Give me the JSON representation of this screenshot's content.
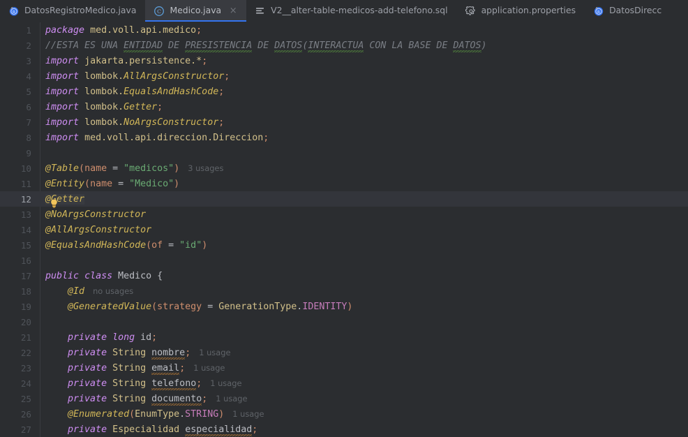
{
  "window": {
    "app": "IntelliJ IDEA",
    "theme_bg": "#2b2d30",
    "accent": "#3574f0"
  },
  "tabbar": {
    "tabs": [
      {
        "label": "DatosRegistroMedico.java",
        "icon": "java-record-icon",
        "active": false,
        "closable": false
      },
      {
        "label": "Medico.java",
        "icon": "java-class-icon",
        "active": true,
        "closable": true,
        "close_label": "×"
      },
      {
        "label": "V2__alter-table-medicos-add-telefono.sql",
        "icon": "sql-file-icon",
        "active": false,
        "closable": false
      },
      {
        "label": "application.properties",
        "icon": "gear-icon",
        "active": false,
        "closable": false
      },
      {
        "label": "DatosDirecc",
        "icon": "java-record-icon",
        "active": false,
        "closable": false
      }
    ]
  },
  "editor": {
    "file": "Medico.java",
    "current_line": 12,
    "lines": [
      {
        "n": 1,
        "text": "package med.voll.api.medico;"
      },
      {
        "n": 2,
        "text": "//ESTA ES UNA ENTIDAD DE PRESISTENCIA DE DATOS(INTERACTUA CON LA BASE DE DATOS)"
      },
      {
        "n": 3,
        "text": "import jakarta.persistence.*;"
      },
      {
        "n": 4,
        "text": "import lombok.AllArgsConstructor;"
      },
      {
        "n": 5,
        "text": "import lombok.EqualsAndHashCode;"
      },
      {
        "n": 6,
        "text": "import lombok.Getter;"
      },
      {
        "n": 7,
        "text": "import lombok.NoArgsConstructor;"
      },
      {
        "n": 8,
        "text": "import med.voll.api.direccion.Direccion;"
      },
      {
        "n": 9,
        "text": ""
      },
      {
        "n": 10,
        "text": "@Table(name = \"medicos\")",
        "hint": "3 usages"
      },
      {
        "n": 11,
        "text": "@Entity(name = \"Medico\")",
        "bulb": true
      },
      {
        "n": 12,
        "text": "@Getter"
      },
      {
        "n": 13,
        "text": "@NoArgsConstructor"
      },
      {
        "n": 14,
        "text": "@AllArgsConstructor"
      },
      {
        "n": 15,
        "text": "@EqualsAndHashCode(of = \"id\")"
      },
      {
        "n": 16,
        "text": ""
      },
      {
        "n": 17,
        "text": "public class Medico {"
      },
      {
        "n": 18,
        "text": "    @Id",
        "hint": "no usages"
      },
      {
        "n": 19,
        "text": "    @GeneratedValue(strategy = GenerationType.IDENTITY)"
      },
      {
        "n": 20,
        "text": ""
      },
      {
        "n": 21,
        "text": "    private long id;"
      },
      {
        "n": 22,
        "text": "    private String nombre;",
        "hint": "1 usage"
      },
      {
        "n": 23,
        "text": "    private String email;",
        "hint": "1 usage"
      },
      {
        "n": 24,
        "text": "    private String telefono;",
        "hint": "1 usage"
      },
      {
        "n": 25,
        "text": "    private String documento;",
        "hint": "1 usage"
      },
      {
        "n": 26,
        "text": "    @Enumerated(EnumType.STRING)",
        "hint": "1 usage"
      },
      {
        "n": 27,
        "text": "    private Especialidad especialidad;"
      }
    ],
    "hints": {
      "three_usages": "3 usages",
      "no_usages": "no usages",
      "one_usage": "1 usage"
    },
    "tokens": {
      "line1": {
        "kw": "package",
        "path": "med.voll.api.medico",
        "semi": ";"
      },
      "line2": {
        "comment_prefix": "//",
        "c1": "ESTA ES UNA ",
        "c2": "ENTIDAD",
        "c3": " DE ",
        "c4": "PRESISTENCIA",
        "c5": " DE ",
        "c6": "DATOS",
        "c7": "(",
        "c8": "INTERACTUA",
        "c9": " CON LA BASE DE ",
        "c10": "DATOS",
        "c11": ")"
      },
      "line3": {
        "kw": "import",
        "path": "jakarta.persistence.*",
        "semi": ";"
      },
      "line4": {
        "kw": "import",
        "pkg": "lombok.",
        "cls": "AllArgsConstructor",
        "semi": ";"
      },
      "line5": {
        "kw": "import",
        "pkg": "lombok.",
        "cls": "EqualsAndHashCode",
        "semi": ";"
      },
      "line6": {
        "kw": "import",
        "pkg": "lombok.",
        "cls": "Getter",
        "semi": ";"
      },
      "line7": {
        "kw": "import",
        "pkg": "lombok.",
        "cls": "NoArgsConstructor",
        "semi": ";"
      },
      "line8": {
        "kw": "import",
        "pkg": "med.voll.api.direccion.",
        "cls": "Direccion",
        "semi": ";"
      },
      "line10": {
        "anno": "@Table",
        "open": "(",
        "param": "name",
        "eq": " = ",
        "str": "\"medicos\"",
        "close": ")"
      },
      "line11": {
        "anno": "@Entity",
        "open": "(",
        "param": "name",
        "eq": " = ",
        "str": "\"Medico\"",
        "close": ")"
      },
      "line12": {
        "anno": "@Getter"
      },
      "line13": {
        "anno": "@NoArgsConstructor"
      },
      "line14": {
        "anno": "@AllArgsConstructor"
      },
      "line15": {
        "anno": "@EqualsAndHashCode",
        "open": "(",
        "param": "of",
        "eq": " = ",
        "str": "\"id\"",
        "close": ")"
      },
      "line17": {
        "kw1": "public",
        "kw2": "class",
        "name": "Medico",
        "brace": "{"
      },
      "line18": {
        "anno": "@Id"
      },
      "line19": {
        "anno": "@GeneratedValue",
        "open": "(",
        "param": "strategy",
        "eq": " = ",
        "type": "GenerationType",
        "dot": ".",
        "const": "IDENTITY",
        "close": ")"
      },
      "line21": {
        "kw1": "private",
        "kw2": "long",
        "name": "id",
        "semi": ";"
      },
      "line22": {
        "kw": "private",
        "type": "String",
        "name": "nombre",
        "semi": ";"
      },
      "line23": {
        "kw": "private",
        "type": "String",
        "name": "email",
        "semi": ";"
      },
      "line24": {
        "kw": "private",
        "type": "String",
        "name": "telefono",
        "semi": ";"
      },
      "line25": {
        "kw": "private",
        "type": "String",
        "name": "documento",
        "semi": ";"
      },
      "line26": {
        "anno": "@Enumerated",
        "open": "(",
        "type": "EnumType",
        "dot": ".",
        "const": "STRING",
        "close": ")"
      },
      "line27": {
        "kw": "private",
        "type": "Especialidad",
        "name": "especialidad",
        "semi": ";"
      }
    }
  }
}
